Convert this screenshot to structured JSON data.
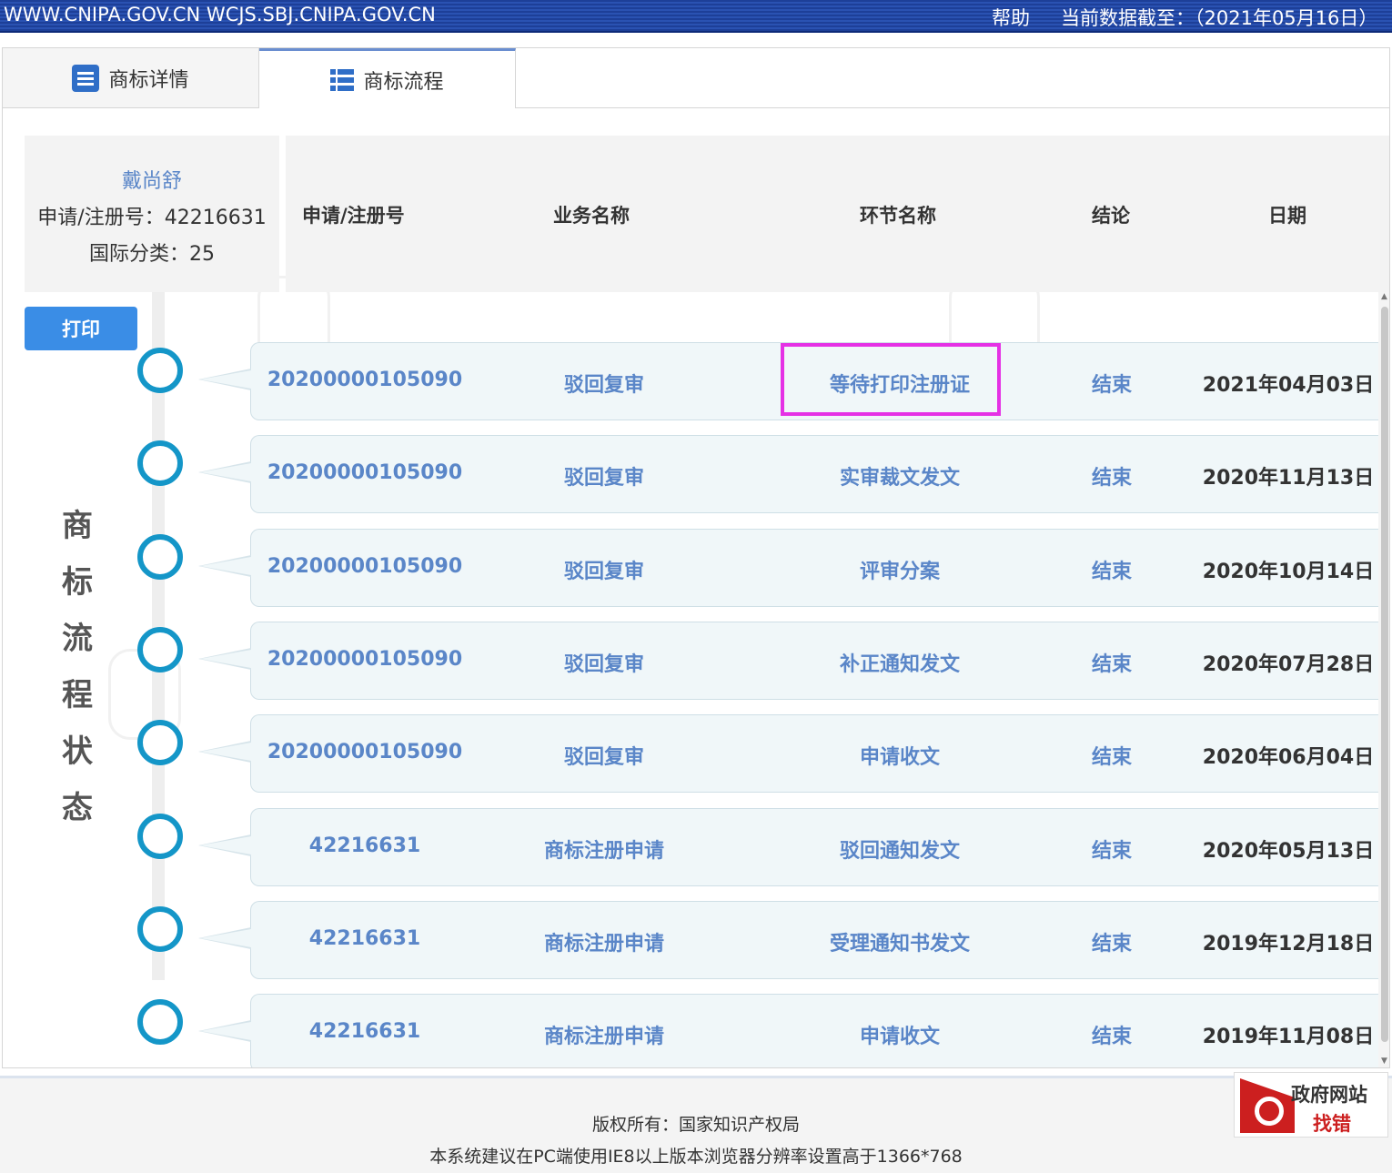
{
  "topbar": {
    "site": "WWW.CNIPA.GOV.CN WCJS.SBJ.CNIPA.GOV.CN",
    "help": "帮助",
    "data_date": "当前数据截至：（2021年05月16日）"
  },
  "tabs": [
    {
      "label": "商标详情",
      "icon": "document-icon"
    },
    {
      "label": "商标流程",
      "icon": "list-icon",
      "active": true
    }
  ],
  "info": {
    "name": "戴尚舒",
    "reg_no": "申请/注册号：42216631",
    "intl_class": "国际分类：25"
  },
  "print_label": "打印",
  "side_title": [
    "商",
    "标",
    "流",
    "程",
    "状",
    "态"
  ],
  "table": {
    "headers": [
      "申请/注册号",
      "业务名称",
      "环节名称",
      "结论",
      "日期"
    ],
    "rows": [
      {
        "no": "20200000105090",
        "biz": "驳回复审",
        "step": "等待打印注册证",
        "result": "结束",
        "date": "2021年04月03日",
        "highlight": true
      },
      {
        "no": "20200000105090",
        "biz": "驳回复审",
        "step": "实审裁文发文",
        "result": "结束",
        "date": "2020年11月13日"
      },
      {
        "no": "20200000105090",
        "biz": "驳回复审",
        "step": "评审分案",
        "result": "结束",
        "date": "2020年10月14日"
      },
      {
        "no": "20200000105090",
        "biz": "驳回复审",
        "step": "补正通知发文",
        "result": "结束",
        "date": "2020年07月28日"
      },
      {
        "no": "20200000105090",
        "biz": "驳回复审",
        "step": "申请收文",
        "result": "结束",
        "date": "2020年06月04日"
      },
      {
        "no": "42216631",
        "biz": "商标注册申请",
        "step": "驳回通知发文",
        "result": "结束",
        "date": "2020年05月13日"
      },
      {
        "no": "42216631",
        "biz": "商标注册申请",
        "step": "受理通知书发文",
        "result": "结束",
        "date": "2019年12月18日"
      },
      {
        "no": "42216631",
        "biz": "商标注册申请",
        "step": "申请收文",
        "result": "结束",
        "date": "2019年11月08日"
      }
    ]
  },
  "footer": {
    "copyright": "版权所有：国家知识产权局",
    "notice": "本系统建议在PC端使用IE8以上版本浏览器分辨率设置高于1366*768"
  },
  "badge": {
    "line1": "政府网站",
    "line2": "找错"
  },
  "colors": {
    "link": "#5a86c8",
    "accent": "#3a8de6",
    "highlight": "#e531e5",
    "timeline": "#1496c8"
  }
}
